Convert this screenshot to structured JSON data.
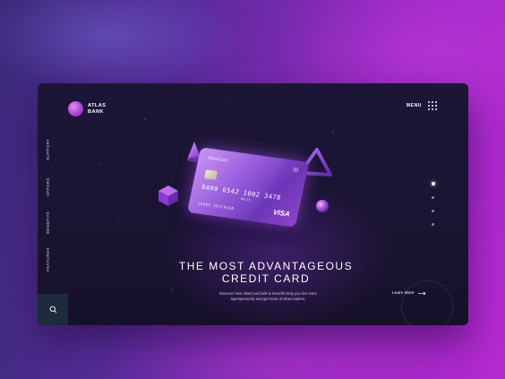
{
  "brand": {
    "name_line1": "ATLAS",
    "name_line2": "BANK"
  },
  "header": {
    "menu_label": "MENU",
    "menu_icon": "grid-icon"
  },
  "sidebar": {
    "items": [
      {
        "label": "SUPPORT"
      },
      {
        "label": "OFFERS"
      },
      {
        "label": "BENEFITS"
      },
      {
        "label": "FEATURES"
      }
    ],
    "search_icon": "search-icon"
  },
  "card": {
    "brand": "AtlasCard",
    "number": "9400 6542 1002 3478",
    "expiry": "04/23",
    "holder": "SERGE ERICKSON",
    "network": "VISA"
  },
  "hero": {
    "title_line1": "THE MOST ADVANTAGEOUS",
    "title_line2": "CREDIT CARD",
    "subtitle_line1": "Discover how AtlasCard built-in benefits help you live more",
    "subtitle_line2": "spontaneously and get more of what matters.",
    "cta_label": "Learn More",
    "cta_icon": "arrow-right-icon"
  },
  "pager": {
    "count": 4,
    "active_index": 0
  },
  "colors": {
    "accent": "#a43fd1",
    "panel_bg": "#1a1432",
    "search_bg": "#1d2b3c",
    "page_gradient_start": "#3a2a7a",
    "page_gradient_end": "#b52ad0"
  }
}
